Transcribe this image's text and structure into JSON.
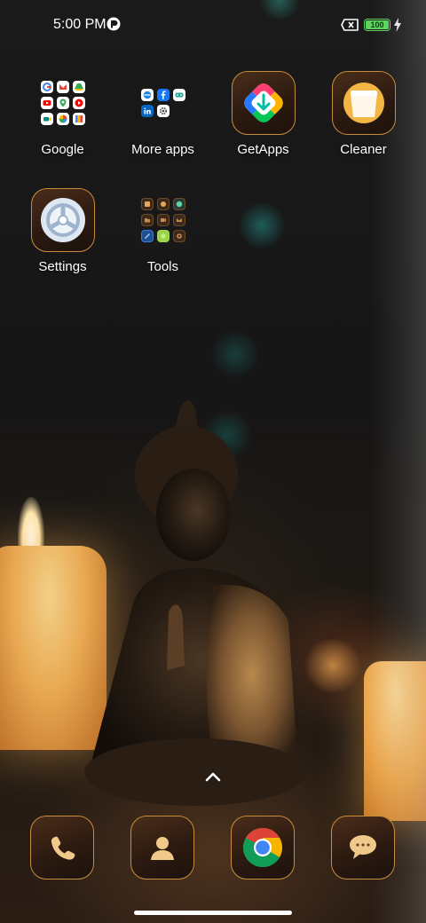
{
  "status_bar": {
    "time": "5:00 PM",
    "battery_level": "100",
    "battery_fraction": 1.0,
    "icons": [
      "notification-app-icon",
      "no-sim-icon",
      "battery-icon",
      "charging-bolt-icon"
    ]
  },
  "home": {
    "apps": [
      {
        "label": "Google",
        "type": "folder",
        "icon": "google-folder-icon"
      },
      {
        "label": "More apps",
        "type": "folder",
        "icon": "more-apps-folder-icon"
      },
      {
        "label": "GetApps",
        "type": "app",
        "icon": "getapps-icon"
      },
      {
        "label": "Cleaner",
        "type": "app",
        "icon": "cleaner-icon"
      },
      {
        "label": "Settings",
        "type": "app",
        "icon": "settings-gear-icon"
      },
      {
        "label": "Tools",
        "type": "folder",
        "icon": "tools-folder-icon"
      }
    ]
  },
  "dock": {
    "apps": [
      {
        "name": "Phone",
        "icon": "phone-icon"
      },
      {
        "name": "Contacts",
        "icon": "contacts-icon"
      },
      {
        "name": "Chrome",
        "icon": "chrome-icon"
      },
      {
        "name": "Messages",
        "icon": "messages-icon"
      }
    ]
  },
  "colors": {
    "accent_frame": "#c88c3a",
    "battery_green": "#5ed35e",
    "folder_bg": "#191919"
  }
}
